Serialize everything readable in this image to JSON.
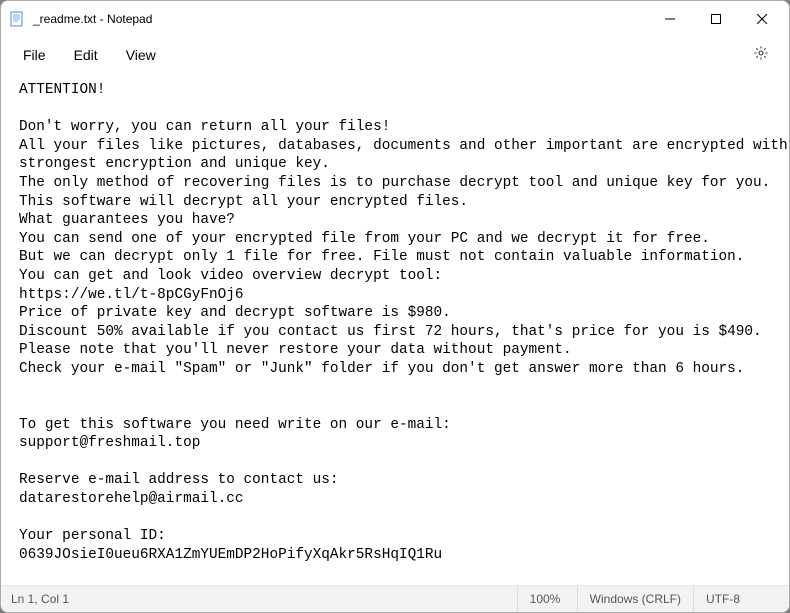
{
  "titlebar": {
    "title": "_readme.txt - Notepad"
  },
  "menubar": {
    "file": "File",
    "edit": "Edit",
    "view": "View"
  },
  "content": {
    "text": "ATTENTION!\n\nDon't worry, you can return all your files!\nAll your files like pictures, databases, documents and other important are encrypted with\nstrongest encryption and unique key.\nThe only method of recovering files is to purchase decrypt tool and unique key for you.\nThis software will decrypt all your encrypted files.\nWhat guarantees you have?\nYou can send one of your encrypted file from your PC and we decrypt it for free.\nBut we can decrypt only 1 file for free. File must not contain valuable information.\nYou can get and look video overview decrypt tool:\nhttps://we.tl/t-8pCGyFnOj6\nPrice of private key and decrypt software is $980.\nDiscount 50% available if you contact us first 72 hours, that's price for you is $490.\nPlease note that you'll never restore your data without payment.\nCheck your e-mail \"Spam\" or \"Junk\" folder if you don't get answer more than 6 hours.\n\n\nTo get this software you need write on our e-mail:\nsupport@freshmail.top\n\nReserve e-mail address to contact us:\ndatarestorehelp@airmail.cc\n\nYour personal ID:\n0639JOsieI0ueu6RXA1ZmYUEmDP2HoPifyXqAkr5RsHqIQ1Ru"
  },
  "statusbar": {
    "position": "Ln 1, Col 1",
    "zoom": "100%",
    "line_ending": "Windows (CRLF)",
    "encoding": "UTF-8"
  }
}
